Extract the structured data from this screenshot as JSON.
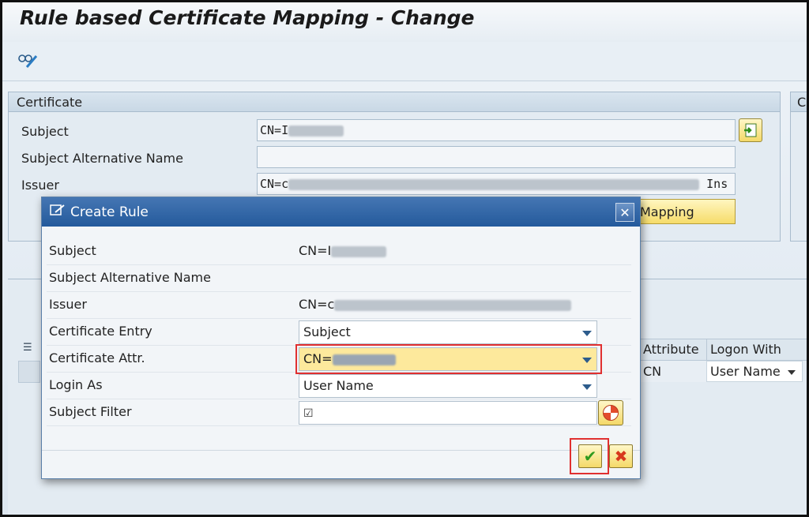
{
  "window": {
    "title": "Rule based Certificate Mapping - Change"
  },
  "toolbar": {
    "display_change_icon": "glasses-pencil-icon"
  },
  "certificate": {
    "header": "Certificate",
    "subject_label": "Subject",
    "subject_value": "CN=I",
    "san_label": "Subject Alternative Name",
    "san_value": "",
    "issuer_label": "Issuer",
    "issuer_value_prefix": "CN=c",
    "issuer_value_suffix": "Ins",
    "mapping_button_label": "Mapping"
  },
  "right_panel": {
    "header": "C"
  },
  "grid": {
    "headers": [
      "Attribute",
      "Logon With"
    ],
    "row": {
      "attribute": "CN",
      "logon_with": "User Name"
    }
  },
  "dialog": {
    "title": "Create Rule",
    "rows": {
      "subject_label": "Subject",
      "subject_value": "CN=I",
      "san_label": "Subject Alternative Name",
      "issuer_label": "Issuer",
      "issuer_value": "CN=c",
      "cert_entry_label": "Certificate Entry",
      "cert_entry_value": "Subject",
      "cert_attr_label": "Certificate Attr.",
      "cert_attr_value": "CN=",
      "login_as_label": "Login As",
      "login_as_value": "User Name",
      "subject_filter_label": "Subject Filter",
      "subject_filter_value": "☑"
    }
  },
  "colors": {
    "accent": "#245a9c",
    "highlight": "#fde99c",
    "button": "#f4d968",
    "callout": "#e03030"
  }
}
